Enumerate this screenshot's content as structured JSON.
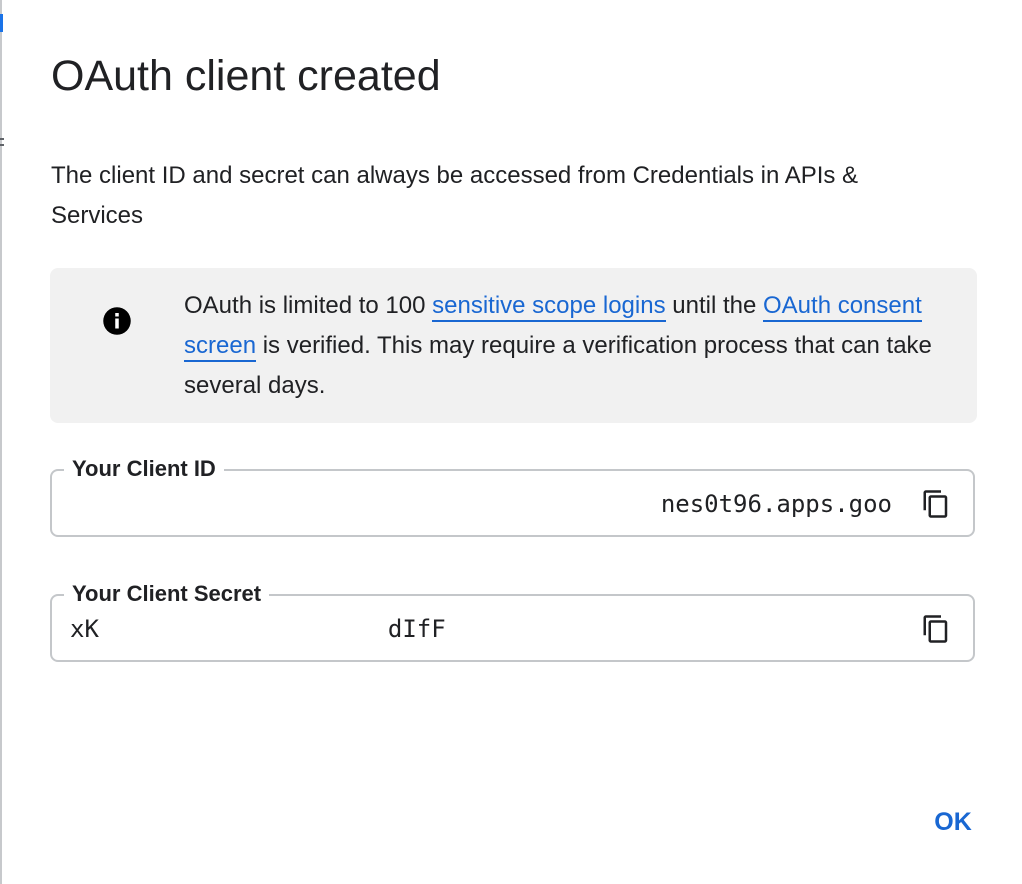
{
  "dialog": {
    "title": "OAuth client created",
    "description": "The client ID and secret can always be accessed from Credentials in APIs & Services"
  },
  "notice": {
    "icon": "info-icon",
    "text_before": "OAuth is limited to 100 ",
    "link1": "sensitive scope logins",
    "text_middle": " until the ",
    "link2": "OAuth consent screen",
    "text_after": " is verified. This may require a verification process that can take several days."
  },
  "fields": {
    "client_id": {
      "label": "Your Client ID",
      "value": "nes0t96.apps.goo",
      "copy_icon": "copy-icon"
    },
    "client_secret": {
      "label": "Your Client Secret",
      "value": "xK                    dIfF",
      "copy_icon": "copy-icon"
    }
  },
  "actions": {
    "ok_label": "OK"
  },
  "colors": {
    "link": "#1967d2",
    "notice_bg": "#f1f1f1",
    "field_border": "#c4c7ca"
  }
}
